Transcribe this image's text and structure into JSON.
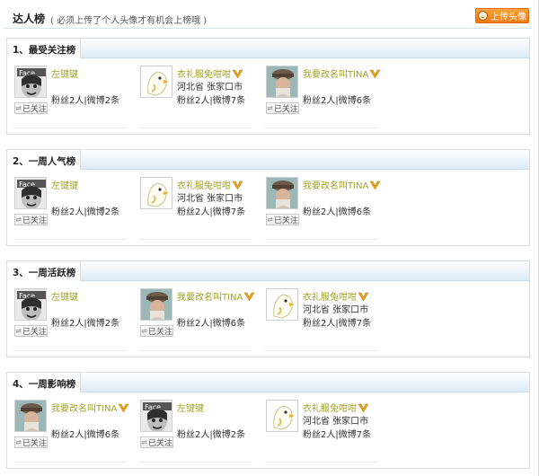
{
  "header": {
    "title": "达人榜",
    "subtitle": "( 必须上传了个人头像才有机会上榜哦 )",
    "upload_label": "上传头像"
  },
  "sections": [
    {
      "title": "1、最受关注榜",
      "users": [
        {
          "name": "左键键",
          "avatar": "sketch-face",
          "vip": false,
          "location": "",
          "stats": "粉丝2人|微博2条",
          "follow_label": "已关注"
        },
        {
          "name": "衣礼服兔咁咁",
          "avatar": "cartoon-bird",
          "vip": true,
          "location": "河北省 张家口市",
          "stats": "粉丝2人|微博7条",
          "follow_label": ""
        },
        {
          "name": "我要改名叫TINA",
          "avatar": "cap-photo",
          "vip": true,
          "location": "",
          "stats": "粉丝2人|微博6条",
          "follow_label": "已关注"
        }
      ]
    },
    {
      "title": "2、一周人气榜",
      "users": [
        {
          "name": "左键键",
          "avatar": "sketch-face",
          "vip": false,
          "location": "",
          "stats": "粉丝2人|微博2条",
          "follow_label": "已关注"
        },
        {
          "name": "衣礼服兔咁咁",
          "avatar": "cartoon-bird",
          "vip": true,
          "location": "河北省 张家口市",
          "stats": "粉丝2人|微博7条",
          "follow_label": ""
        },
        {
          "name": "我要改名叫TINA",
          "avatar": "cap-photo",
          "vip": true,
          "location": "",
          "stats": "粉丝2人|微博6条",
          "follow_label": "已关注"
        }
      ]
    },
    {
      "title": "3、一周活跃榜",
      "users": [
        {
          "name": "左键键",
          "avatar": "sketch-face",
          "vip": false,
          "location": "",
          "stats": "粉丝2人|微博2条",
          "follow_label": "已关注"
        },
        {
          "name": "我要改名叫TINA",
          "avatar": "cap-photo",
          "vip": true,
          "location": "",
          "stats": "粉丝2人|微博6条",
          "follow_label": "已关注"
        },
        {
          "name": "衣礼服兔咁咁",
          "avatar": "cartoon-bird",
          "vip": true,
          "location": "河北省 张家口市",
          "stats": "粉丝2人|微博7条",
          "follow_label": ""
        }
      ]
    },
    {
      "title": "4、一周影响榜",
      "users": [
        {
          "name": "我要改名叫TINA",
          "avatar": "cap-photo",
          "vip": true,
          "location": "",
          "stats": "粉丝2人|微博6条",
          "follow_label": "已关注"
        },
        {
          "name": "左键键",
          "avatar": "sketch-face",
          "vip": false,
          "location": "",
          "stats": "粉丝2人|微博2条",
          "follow_label": "已关注"
        },
        {
          "name": "衣礼服兔咁咁",
          "avatar": "cartoon-bird",
          "vip": true,
          "location": "河北省 张家口市",
          "stats": "粉丝2人|微博7条",
          "follow_label": ""
        }
      ]
    }
  ],
  "colors": {
    "name_link": "#a0a22a",
    "vip_badge": "#e8a21a",
    "header_gradient_end": "#dcebf7",
    "upload_button": "#f27a0c"
  }
}
